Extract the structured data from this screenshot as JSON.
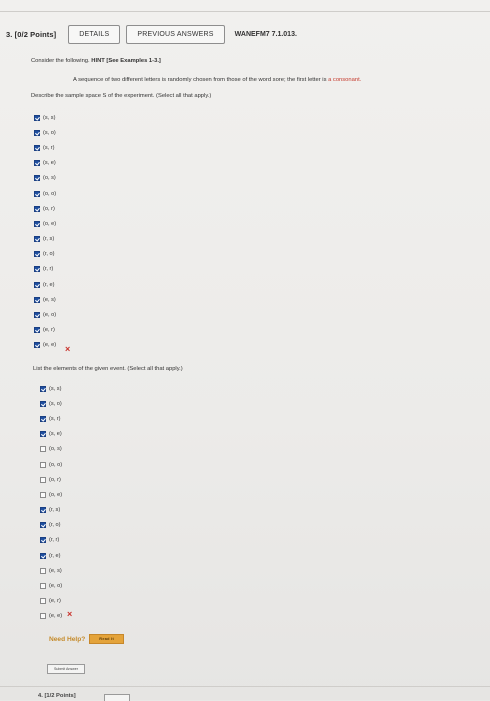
{
  "question": {
    "number_label": "3.",
    "points_label": "[0/2 Points]",
    "details_label": "DETAILS",
    "previous_answers_label": "PREVIOUS ANSWERS",
    "code": "WANEFM7 7.1.013."
  },
  "instructions": {
    "consider": "Consider the following. ",
    "hint": "HINT [See Examples 1-3.]",
    "scenario_a": "A sequence of two different letters is randomly chosen from those of the word sore; the first letter is ",
    "scenario_b": "a consonant.",
    "part1_prompt": "Describe the sample space S of the experiment. (Select all that apply.)",
    "part2_prompt": "List the elements of the given event. (Select all that apply.)"
  },
  "part1_options": [
    {
      "label": "(s, s)",
      "checked": true
    },
    {
      "label": "(s, o)",
      "checked": true
    },
    {
      "label": "(s, r)",
      "checked": true
    },
    {
      "label": "(s, e)",
      "checked": true
    },
    {
      "label": "(o, s)",
      "checked": true
    },
    {
      "label": "(o, o)",
      "checked": true
    },
    {
      "label": "(o, r)",
      "checked": true
    },
    {
      "label": "(o, e)",
      "checked": true
    },
    {
      "label": "(r, s)",
      "checked": true
    },
    {
      "label": "(r, o)",
      "checked": true
    },
    {
      "label": "(r, r)",
      "checked": true
    },
    {
      "label": "(r, e)",
      "checked": true
    },
    {
      "label": "(e, s)",
      "checked": true
    },
    {
      "label": "(e, o)",
      "checked": true
    },
    {
      "label": "(e, r)",
      "checked": true
    },
    {
      "label": "(e, e)",
      "checked": true
    }
  ],
  "part2_options": [
    {
      "label": "(s, s)",
      "checked": true
    },
    {
      "label": "(s, o)",
      "checked": true
    },
    {
      "label": "(s, r)",
      "checked": true
    },
    {
      "label": "(s, e)",
      "checked": true
    },
    {
      "label": "(o, s)",
      "checked": false
    },
    {
      "label": "(o, o)",
      "checked": false
    },
    {
      "label": "(o, r)",
      "checked": false
    },
    {
      "label": "(o, e)",
      "checked": false
    },
    {
      "label": "(r, s)",
      "checked": true
    },
    {
      "label": "(r, o)",
      "checked": true
    },
    {
      "label": "(r, r)",
      "checked": true
    },
    {
      "label": "(r, e)",
      "checked": true
    },
    {
      "label": "(e, s)",
      "checked": false
    },
    {
      "label": "(e, o)",
      "checked": false
    },
    {
      "label": "(e, r)",
      "checked": false
    },
    {
      "label": "(e, e)",
      "checked": false
    }
  ],
  "feedback": {
    "part1_icon": "incorrect-x-icon",
    "part2_icon": "incorrect-x-icon",
    "mark_glyph": "×"
  },
  "help": {
    "label": "Need Help?",
    "read_it_label": "Read It"
  },
  "submit_label": "Submit Answer",
  "next_question_label": "4. [1/2 Points]"
}
